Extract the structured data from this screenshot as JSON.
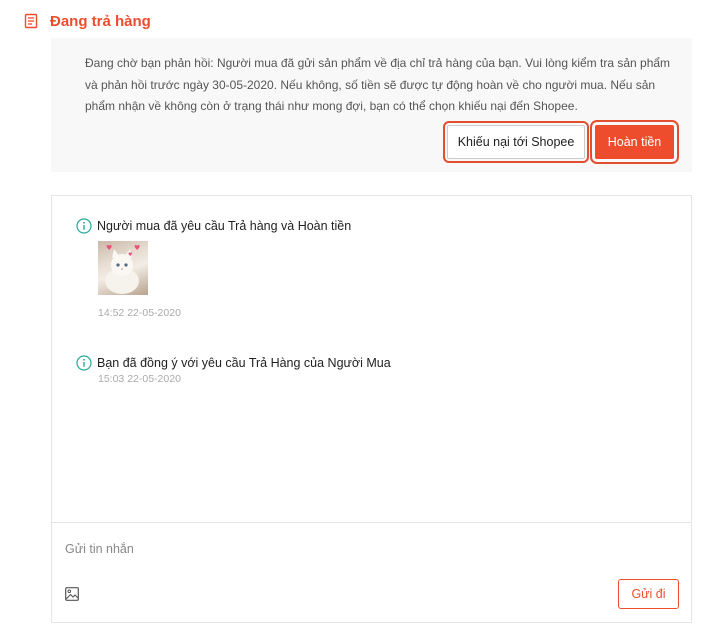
{
  "header": {
    "icon": "document-icon",
    "title": "Đang trả hàng"
  },
  "notice": {
    "message": "Đang chờ bạn phản hồi: Người mua đã gửi sản phẩm về địa chỉ trả hàng của bạn. Vui lòng kiểm tra sản phẩm và phản hồi trước ngày 30-05-2020. Nếu không, số tiền sẽ được tự động hoàn về cho người mua. Nếu sản phẩm nhận về không còn ở trạng thái như mong đợi, bạn có thể chọn khiếu nại đến Shopee.",
    "complain_button": "Khiếu nại tới Shopee",
    "refund_button": "Hoàn tiền"
  },
  "timeline": [
    {
      "icon": "info-icon",
      "text": "Người mua đã yêu cầu Trả hàng và Hoàn tiền",
      "time": "14:52 22-05-2020",
      "has_image": true
    },
    {
      "icon": "info-icon",
      "text": "Bạn đã đồng ý với yêu cầu Trả Hàng của Người Mua",
      "time": "15:03 22-05-2020",
      "has_image": false
    }
  ],
  "composer": {
    "placeholder": "Gửi tin nhắn",
    "image_icon": "image-icon",
    "send_button": "Gửi đi"
  },
  "colors": {
    "accent": "#ee4d2d",
    "highlight_box": "#e24f2f",
    "notice_bg": "#f8f8f8"
  }
}
